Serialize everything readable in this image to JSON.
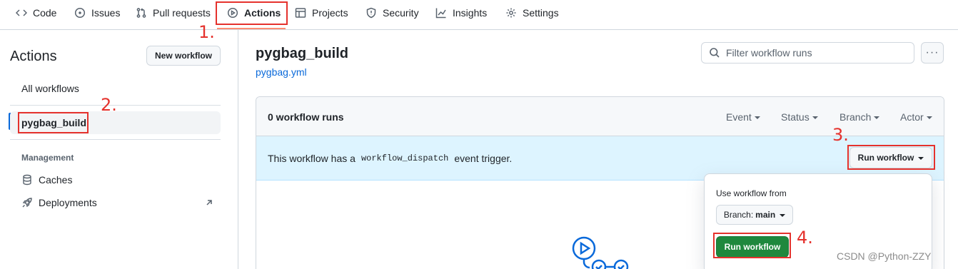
{
  "nav": {
    "tabs": [
      {
        "label": "Code",
        "icon": "code-icon"
      },
      {
        "label": "Issues",
        "icon": "issue-opened-icon"
      },
      {
        "label": "Pull requests",
        "icon": "git-pull-request-icon"
      },
      {
        "label": "Actions",
        "icon": "play-icon",
        "active": true
      },
      {
        "label": "Projects",
        "icon": "table-icon"
      },
      {
        "label": "Security",
        "icon": "shield-icon"
      },
      {
        "label": "Insights",
        "icon": "graph-icon"
      },
      {
        "label": "Settings",
        "icon": "gear-icon"
      }
    ]
  },
  "sidebar": {
    "title": "Actions",
    "new_workflow": "New workflow",
    "all_workflows": "All workflows",
    "selected_workflow": "pygbag_build",
    "management_heading": "Management",
    "links": [
      {
        "label": "Caches",
        "icon": "database-icon"
      },
      {
        "label": "Deployments",
        "icon": "rocket-icon",
        "trailing_icon": "arrow-up-right-icon"
      }
    ]
  },
  "main": {
    "workflow_title": "pygbag_build",
    "workflow_file": "pygbag.yml",
    "filter_placeholder": "Filter workflow runs",
    "more_label": "···",
    "runs_count": "0 workflow runs",
    "filters": [
      "Event",
      "Status",
      "Branch",
      "Actor"
    ],
    "dispatch": {
      "before": "This workflow has a",
      "code": "workflow_dispatch",
      "after": "event trigger."
    },
    "run_workflow_button": "Run workflow"
  },
  "popover": {
    "label": "Use workflow from",
    "branch_prefix": "Branch:",
    "branch_value": "main",
    "run_button": "Run workflow"
  },
  "annotations": [
    "1.",
    "2.",
    "3.",
    "4."
  ],
  "watermark": "CSDN @Python-ZZY",
  "colors": {
    "accent_blue": "#0969da",
    "underline": "#fd8c73",
    "annotation_red": "#e5322d",
    "green": "#1f883d",
    "dispatch_bg": "#ddf4ff"
  }
}
